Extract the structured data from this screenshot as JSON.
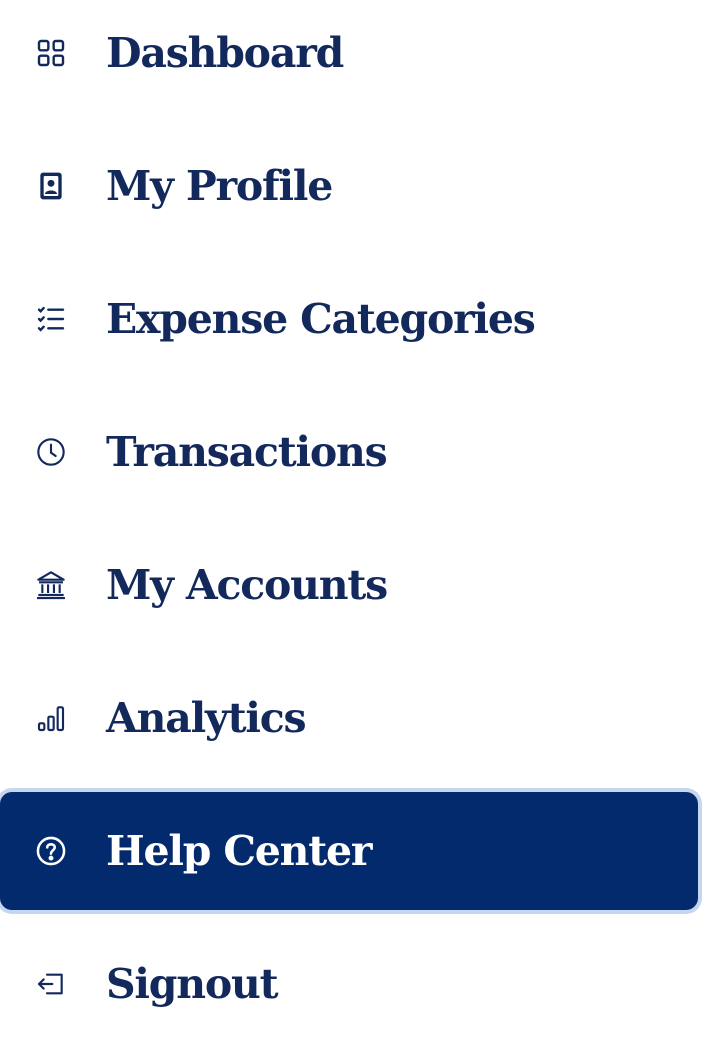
{
  "sidebar": {
    "accent_color": "#032a6d",
    "text_color": "#13295c",
    "items": [
      {
        "label": "Dashboard",
        "icon": "grid-icon",
        "active": false
      },
      {
        "label": "My Profile",
        "icon": "profile-badge-icon",
        "active": false
      },
      {
        "label": "Expense Categories",
        "icon": "list-icon",
        "active": false
      },
      {
        "label": "Transactions",
        "icon": "clock-icon",
        "active": false
      },
      {
        "label": "My Accounts",
        "icon": "bank-icon",
        "active": false
      },
      {
        "label": "Analytics",
        "icon": "bar-chart-icon",
        "active": false
      },
      {
        "label": "Help Center",
        "icon": "help-circle-icon",
        "active": true
      },
      {
        "label": "Signout",
        "icon": "signout-icon",
        "active": false
      }
    ]
  }
}
